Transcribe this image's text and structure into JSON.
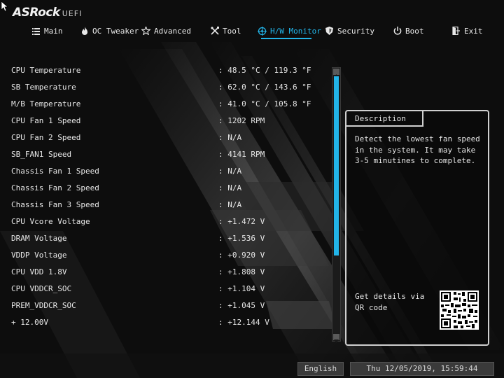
{
  "header": {
    "brand": "ASRock",
    "suffix": "UEFI"
  },
  "nav": {
    "active": "hw-monitor",
    "items": [
      {
        "id": "main",
        "label": "Main",
        "icon": "list-icon"
      },
      {
        "id": "oc-tweaker",
        "label": "OC Tweaker",
        "icon": "flame-icon"
      },
      {
        "id": "advanced",
        "label": "Advanced",
        "icon": "star-icon"
      },
      {
        "id": "tool",
        "label": "Tool",
        "icon": "tools-icon"
      },
      {
        "id": "hw-monitor",
        "label": "H/W Monitor",
        "icon": "monitor-target-icon"
      },
      {
        "id": "security",
        "label": "Security",
        "icon": "shield-icon"
      },
      {
        "id": "boot",
        "label": "Boot",
        "icon": "power-icon"
      },
      {
        "id": "exit",
        "label": "Exit",
        "icon": "exit-door-icon"
      }
    ]
  },
  "monitor": {
    "rows": [
      {
        "label": "CPU Temperature",
        "value": ": 48.5 °C / 119.3 °F"
      },
      {
        "label": "SB Temperature",
        "value": ": 62.0 °C / 143.6 °F"
      },
      {
        "label": "M/B Temperature",
        "value": ": 41.0 °C / 105.8 °F"
      },
      {
        "label": "CPU Fan 1 Speed",
        "value": ": 1202 RPM"
      },
      {
        "label": "CPU Fan 2 Speed",
        "value": ": N/A"
      },
      {
        "label": "SB_FAN1 Speed",
        "value": ": 4141 RPM"
      },
      {
        "label": "Chassis Fan 1 Speed",
        "value": ": N/A"
      },
      {
        "label": "Chassis Fan 2 Speed",
        "value": ": N/A"
      },
      {
        "label": "Chassis Fan 3 Speed",
        "value": ": N/A"
      },
      {
        "label": "CPU Vcore Voltage",
        "value": ": +1.472 V"
      },
      {
        "label": "DRAM Voltage",
        "value": ": +1.536 V"
      },
      {
        "label": "VDDP Voltage",
        "value": ": +0.920 V"
      },
      {
        "label": "CPU VDD 1.8V",
        "value": ": +1.808 V"
      },
      {
        "label": "CPU VDDCR_SOC",
        "value": ": +1.104 V"
      },
      {
        "label": "PREM_VDDCR_SOC",
        "value": ": +1.045 V"
      },
      {
        "label": "+ 12.00V",
        "value": ": +12.144 V"
      }
    ]
  },
  "description": {
    "title": "Description",
    "body": "Detect the lowest fan speed in the system. It may take 3-5 minutines to complete.",
    "footer": "Get details via QR code"
  },
  "status": {
    "language": "English",
    "datetime": "Thu 12/05/2019, 15:59:44"
  },
  "colors": {
    "accent": "#22b4e8",
    "background": "#0d0d0d",
    "text": "#e6e6e6"
  }
}
